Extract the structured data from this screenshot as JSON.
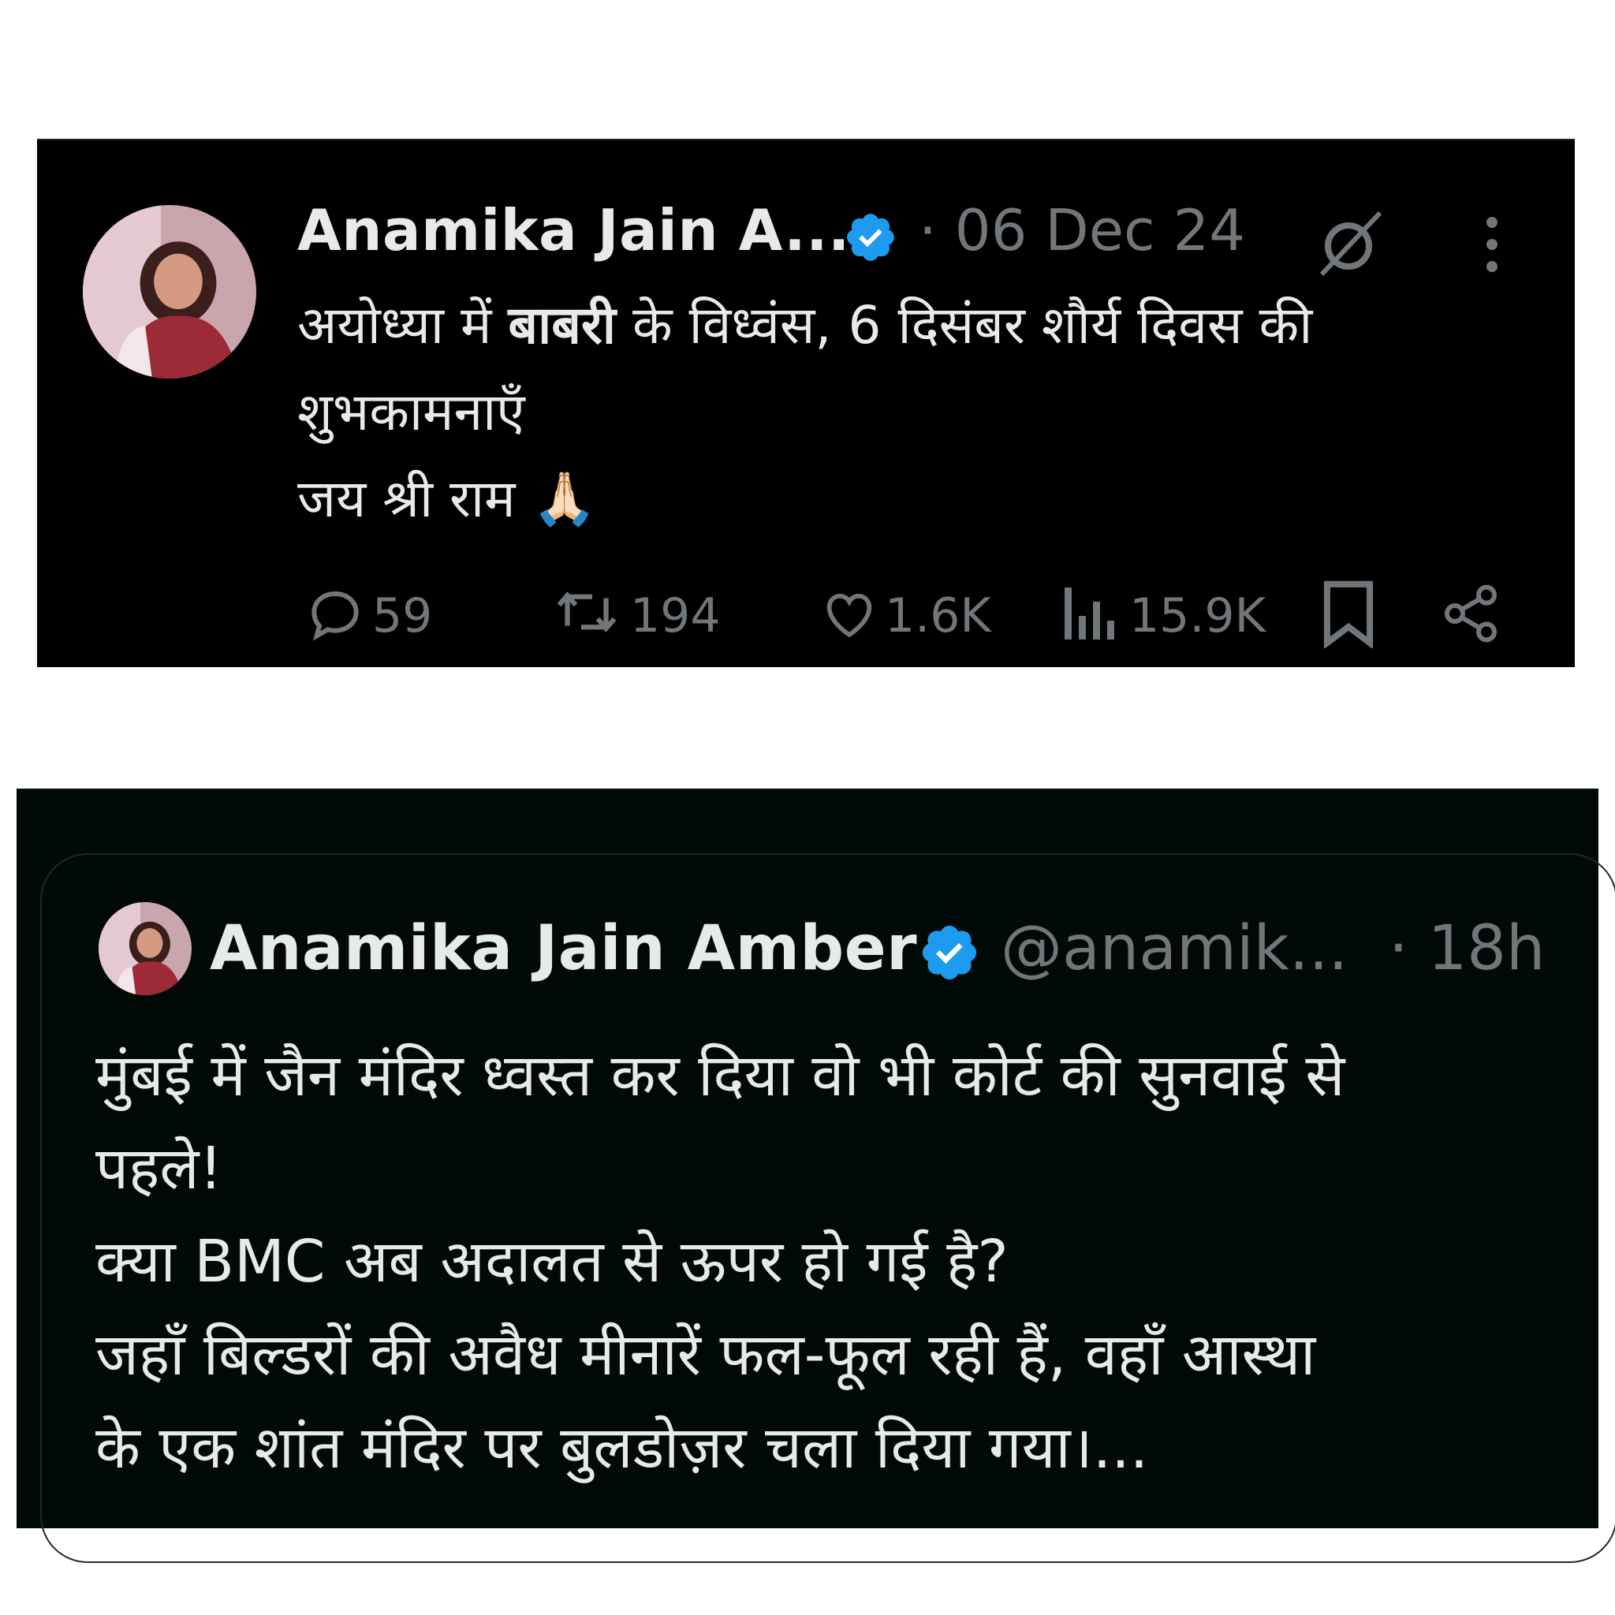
{
  "tweet1": {
    "author_name": "Anamika Jain A...",
    "date": "· 06 Dec 24",
    "text": {
      "line1_pre": "अयोध्या में ",
      "line1_bold": "बाबरी",
      "line1_post": "  के विध्वंस, 6 दिसंबर शौर्य दिवस की",
      "line2": "शुभकामनाएँ",
      "line3": "जय श्री राम 🙏🏻"
    },
    "actions": {
      "replies": "59",
      "reposts": "194",
      "likes": "1.6K",
      "views": "15.9K"
    },
    "icons": [
      "grok-icon",
      "more-options-icon",
      "reply-icon",
      "repost-icon",
      "like-icon",
      "views-icon",
      "bookmark-icon",
      "share-icon"
    ]
  },
  "tweet2": {
    "author_name": "Anamika Jain Amber",
    "handle": "@anamik...",
    "time": "· 18h",
    "text": {
      "line1": "मुंबई में जैन मंदिर ध्वस्त कर दिया वो भी कोर्ट की सुनवाई से",
      "line2": "पहले!",
      "line3": "क्या BMC अब अदालत से ऊपर हो गई है?",
      "line4": "जहाँ बिल्डरों की अवैध मीनारें फल-फूल रही हैं, वहाँ आस्था",
      "line5": "के एक शांत मंदिर पर बुलडोज़र चला दिया गया।..."
    }
  },
  "colors": {
    "background": "#000000",
    "text": "#e7e9ea",
    "muted": "#71767b",
    "verified": "#1d9bf0"
  }
}
